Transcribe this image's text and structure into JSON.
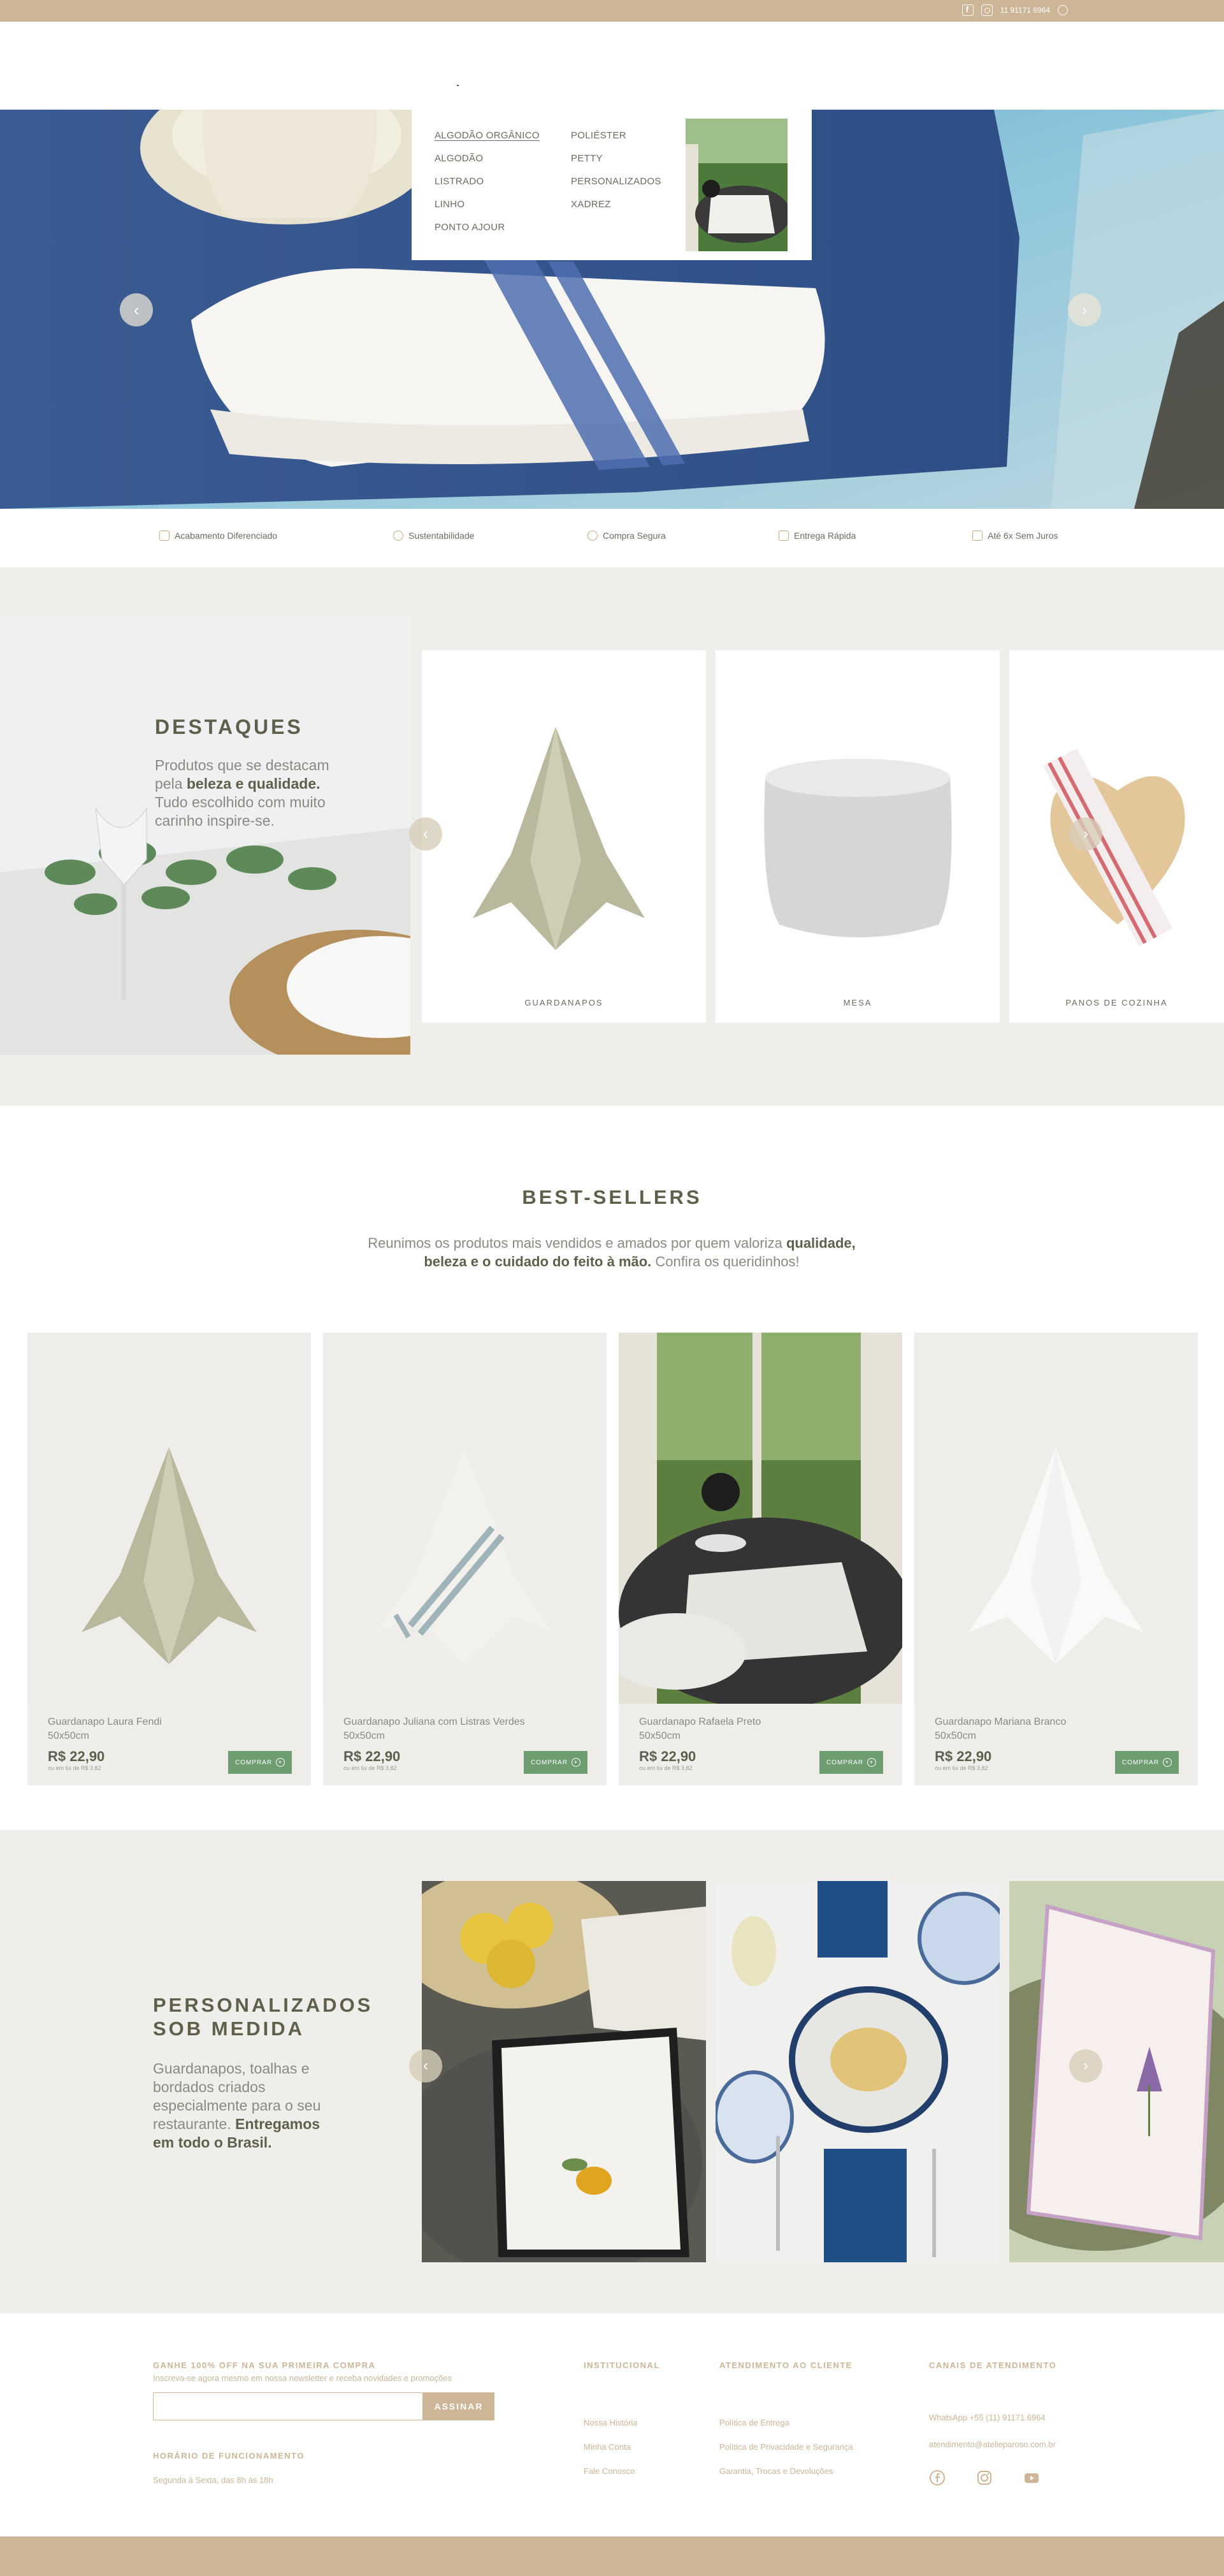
{
  "topbar": {
    "phone": "11 91171 6964",
    "icons": [
      "facebook-icon",
      "instagram-icon",
      "whatsapp-icon"
    ]
  },
  "megamenu": {
    "col1": [
      "ALGODÃO ORGÂNICO",
      "ALGODÃO",
      "LISTRADO",
      "LINHO",
      "PONTO AJOUR"
    ],
    "col2": [
      "POLIÉSTER",
      "PETTY",
      "PERSONALIZADOS",
      "XADREZ"
    ]
  },
  "features": [
    {
      "label": "Acabamento Diferenciado",
      "icon": "scissors-icon"
    },
    {
      "label": "Sustentabilidade",
      "icon": "leaf-icon"
    },
    {
      "label": "Compra Segura",
      "icon": "shield-icon"
    },
    {
      "label": "Entrega Rápida",
      "icon": "truck-icon"
    },
    {
      "label": "Até 6x Sem Juros",
      "icon": "credit-card-icon"
    }
  ],
  "destaques": {
    "title": "DESTAQUES",
    "text_1": "Produtos que se destacam pela ",
    "text_bold": "beleza e qualidade.",
    "text_2": " Tudo escolhido com muito carinho inspire-se.",
    "categories": [
      "GUARDANAPOS",
      "MESA",
      "PANOS DE COZINHA"
    ]
  },
  "bestsellers": {
    "title": "BEST-SELLERS",
    "text_1": "Reunimos os produtos mais vendidos e amados por quem valoriza ",
    "text_bold1": "qualidade, beleza e o cuidado do feito à mão.",
    "text_2": " Confira os queridinhos!",
    "products": [
      {
        "name": "Guardanapo Laura Fendi",
        "size": "50x50cm",
        "price": "R$ 22,90",
        "old": "ou em 6x de R$ 3,82",
        "button": "COMPRAR"
      },
      {
        "name": "Guardanapo Juliana com Listras Verdes",
        "size": "50x50cm",
        "price": "R$ 22,90",
        "old": "ou em 6x de R$ 3,82",
        "button": "COMPRAR"
      },
      {
        "name": "Guardanapo Rafaela Preto",
        "size": "50x50cm",
        "price": "R$ 22,90",
        "old": "ou em 6x de R$ 3,82",
        "button": "COMPRAR"
      },
      {
        "name": "Guardanapo Mariana Branco",
        "size": "50x50cm",
        "price": "R$ 22,90",
        "old": "ou em 6x de R$ 3,82",
        "button": "COMPRAR"
      }
    ]
  },
  "personalizados": {
    "title": "PERSONALIZADOS SOB MEDIDA",
    "text_1": "Guardanapos, toalhas e bordados criados especialmente para o seu restaurante. ",
    "text_bold": "Entregamos em todo o Brasil."
  },
  "footer": {
    "newsletter_title": "GANHE 100% OFF NA SUA PRIMEIRA COMPRA",
    "newsletter_text": "Inscreva-se agora mesmo em nossa newsletter e receba novidades e promoções",
    "newsletter_button": "ASSINAR",
    "newsletter_placeholder": "",
    "hours_title": "HORÁRIO DE FUNCIONAMENTO",
    "hours_text": "Segunda à Sexta, das 8h às 18h",
    "institucional_title": "INSTITUCIONAL",
    "institucional_links": [
      "Nossa História",
      "Minha Conta",
      "Fale Conosco"
    ],
    "atendimento_title": "ATENDIMENTO AO CLIENTE",
    "atendimento_links": [
      "Política de Entrega",
      "Política de Privacidade e Segurança",
      "Garantia, Trocas e Devoluções"
    ],
    "canais_title": "CANAIS DE ATENDIMENTO",
    "whatsapp": "WhatsApp +55 (11) 91171.6964",
    "email": "atendimento@atelieparoso.com.br"
  },
  "colors": {
    "accent": "#cdb597",
    "section_bg": "#efeeea",
    "buy_button": "#6f9d72",
    "title_text": "#5f5f4b"
  }
}
